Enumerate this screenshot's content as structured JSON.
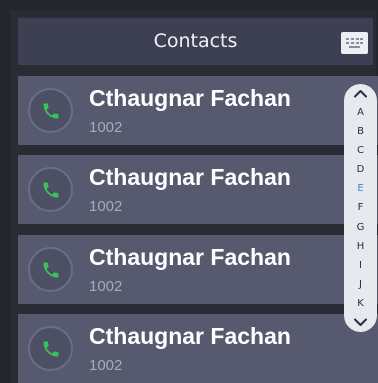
{
  "header": {
    "title": "Contacts"
  },
  "contacts": [
    {
      "name": "Cthaugnar Fachan",
      "number": "1002"
    },
    {
      "name": "Cthaugnar Fachan",
      "number": "1002"
    },
    {
      "name": "Cthaugnar Fachan",
      "number": "1002"
    },
    {
      "name": "Cthaugnar Fachan",
      "number": "1002"
    }
  ],
  "alpha_index": {
    "letters": [
      "A",
      "B",
      "C",
      "D",
      "E",
      "F",
      "G",
      "H",
      "I",
      "J",
      "K"
    ],
    "active": "E",
    "active_color": "#3d7fe2"
  },
  "colors": {
    "call_icon": "#38c25a",
    "header_bg": "#3d4052",
    "card_bg": "#575a6f"
  },
  "icons": {
    "call": "phone-icon",
    "keypad": "dialpad-icon",
    "scroll_up": "chevron-up-icon",
    "scroll_down": "chevron-down-icon"
  }
}
